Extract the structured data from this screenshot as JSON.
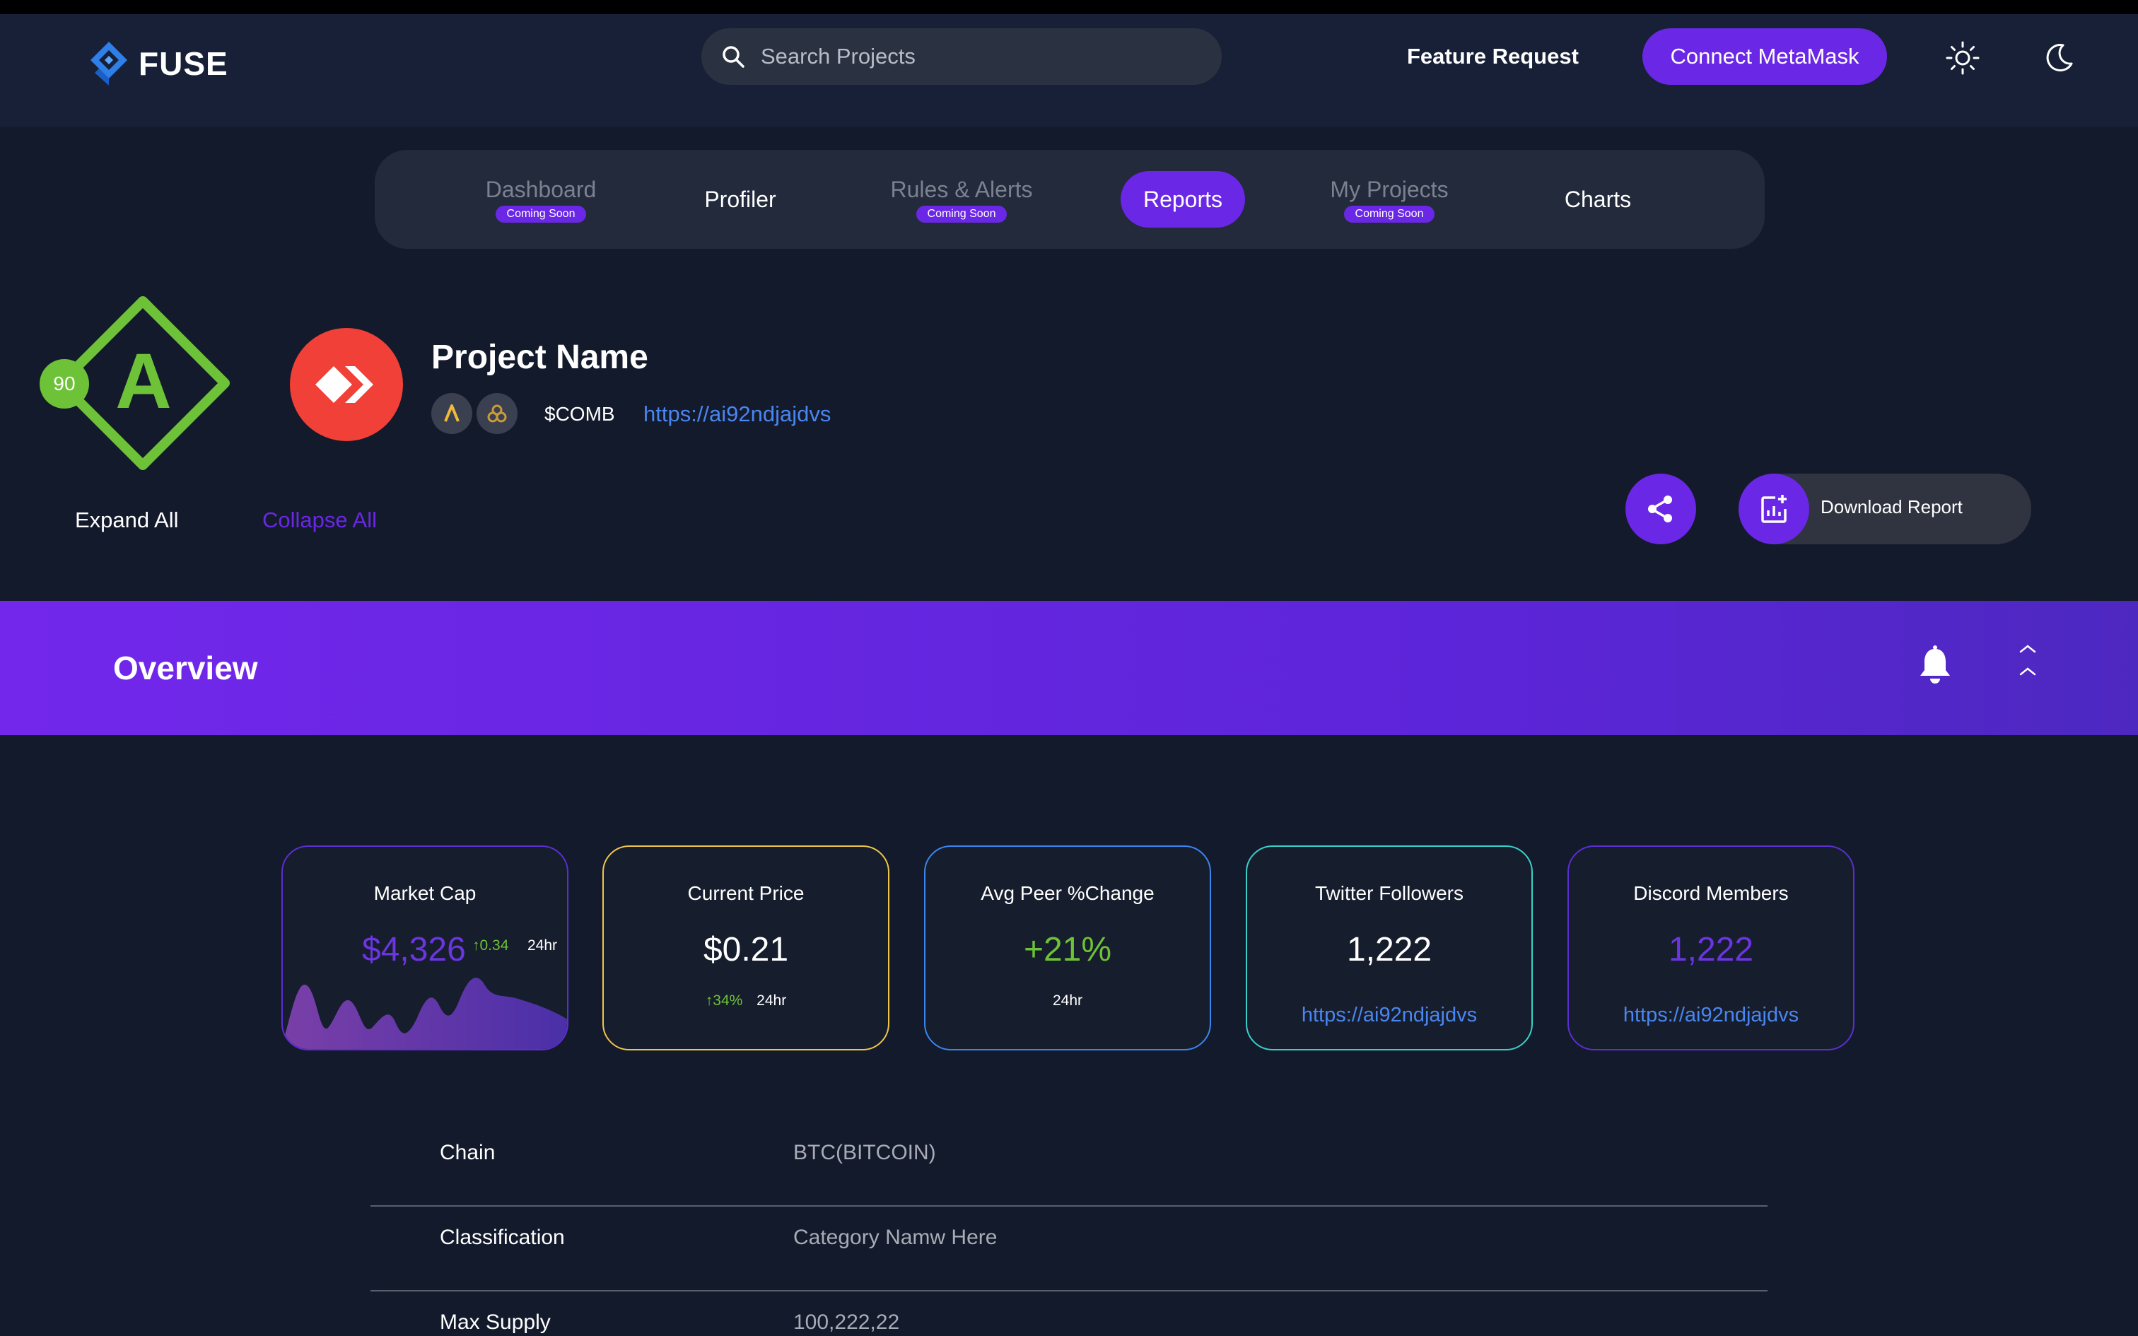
{
  "header": {
    "brand": "FUSE",
    "search_placeholder": "Search Projects",
    "feature_request": "Feature Request",
    "connect_label": "Connect MetaMask"
  },
  "nav": {
    "items": [
      {
        "label": "Dashboard",
        "badge": "Coming Soon"
      },
      {
        "label": "Profiler"
      },
      {
        "label": "Rules & Alerts",
        "badge": "Coming Soon"
      },
      {
        "label": "Reports",
        "active": true
      },
      {
        "label": "My Projects",
        "badge": "Coming Soon"
      },
      {
        "label": "Charts"
      }
    ]
  },
  "project": {
    "grade": "A",
    "score": "90",
    "name": "Project Name",
    "ticker": "$COMB",
    "link": "https://ai92ndjajdvs",
    "expand_all": "Expand All",
    "collapse_all": "Collapse All",
    "download_label": "Download Report"
  },
  "overview": {
    "title": "Overview"
  },
  "cards": {
    "market_cap": {
      "title": "Market Cap",
      "value": "$4,326",
      "change": "↑0.34",
      "period": "24hr"
    },
    "current_price": {
      "title": "Current Price",
      "value": "$0.21",
      "change": "↑34%",
      "period": "24hr"
    },
    "avg_peer": {
      "title": "Avg Peer %Change",
      "value": "+21%",
      "period": "24hr"
    },
    "twitter": {
      "title": "Twitter Followers",
      "value": "1,222",
      "link": "https://ai92ndjajdvs"
    },
    "discord": {
      "title": "Discord Members",
      "value": "1,222",
      "link": "https://ai92ndjajdvs"
    }
  },
  "details": [
    {
      "key": "Chain",
      "value": "BTC(BITCOIN)"
    },
    {
      "key": "Classification",
      "value": "Category Namw Here"
    },
    {
      "key": "Max Supply",
      "value": "100,222,22"
    }
  ],
  "colors": {
    "accent": "#6b27e6",
    "grade_green": "#6dc238",
    "link_blue": "#4a86f0",
    "card_border_purple": "#5a2fd0",
    "card_border_yellow": "#f0c64a",
    "card_border_blue": "#3a86f0",
    "card_border_teal": "#3ad0c8"
  }
}
